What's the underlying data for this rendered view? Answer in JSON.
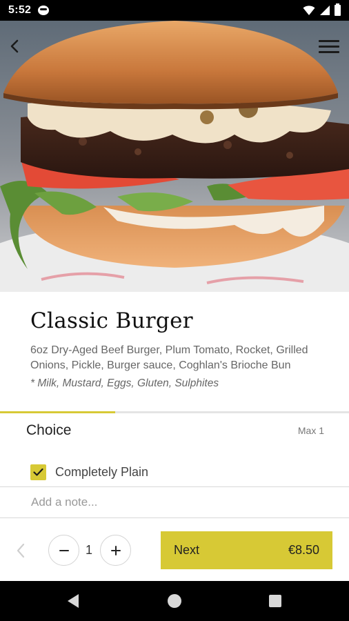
{
  "status_bar": {
    "time": "5:52",
    "icons": [
      "message-icon",
      "wifi-icon",
      "signal-icon",
      "battery-icon"
    ]
  },
  "header": {
    "back_icon": "chevron-left-icon",
    "menu_icon": "hamburger-menu-icon",
    "hero_image": "burger-photo"
  },
  "product": {
    "title": "Classic Burger",
    "description": "6oz Dry-Aged Beef Burger, Plum Tomato, Rocket, Grilled Onions, Pickle, Burger sauce, Coghlan's Brioche Bun",
    "allergens": "* Milk, Mustard, Eggs, Gluten, Sulphites"
  },
  "progress": {
    "fraction": 0.33
  },
  "choice": {
    "title": "Choice",
    "max_label": "Max 1",
    "options": [
      {
        "label": "Completely Plain",
        "checked": true
      }
    ]
  },
  "note": {
    "placeholder": "Add a note...",
    "value": ""
  },
  "action_bar": {
    "prev_icon": "chevron-left-icon",
    "minus_icon": "minus-icon",
    "plus_icon": "plus-icon",
    "quantity": "1",
    "next_label": "Next",
    "price": "€8.50"
  },
  "colors": {
    "accent": "#d7c935",
    "status_bar": "#000000",
    "text_primary": "#111111",
    "text_secondary": "#666666"
  }
}
